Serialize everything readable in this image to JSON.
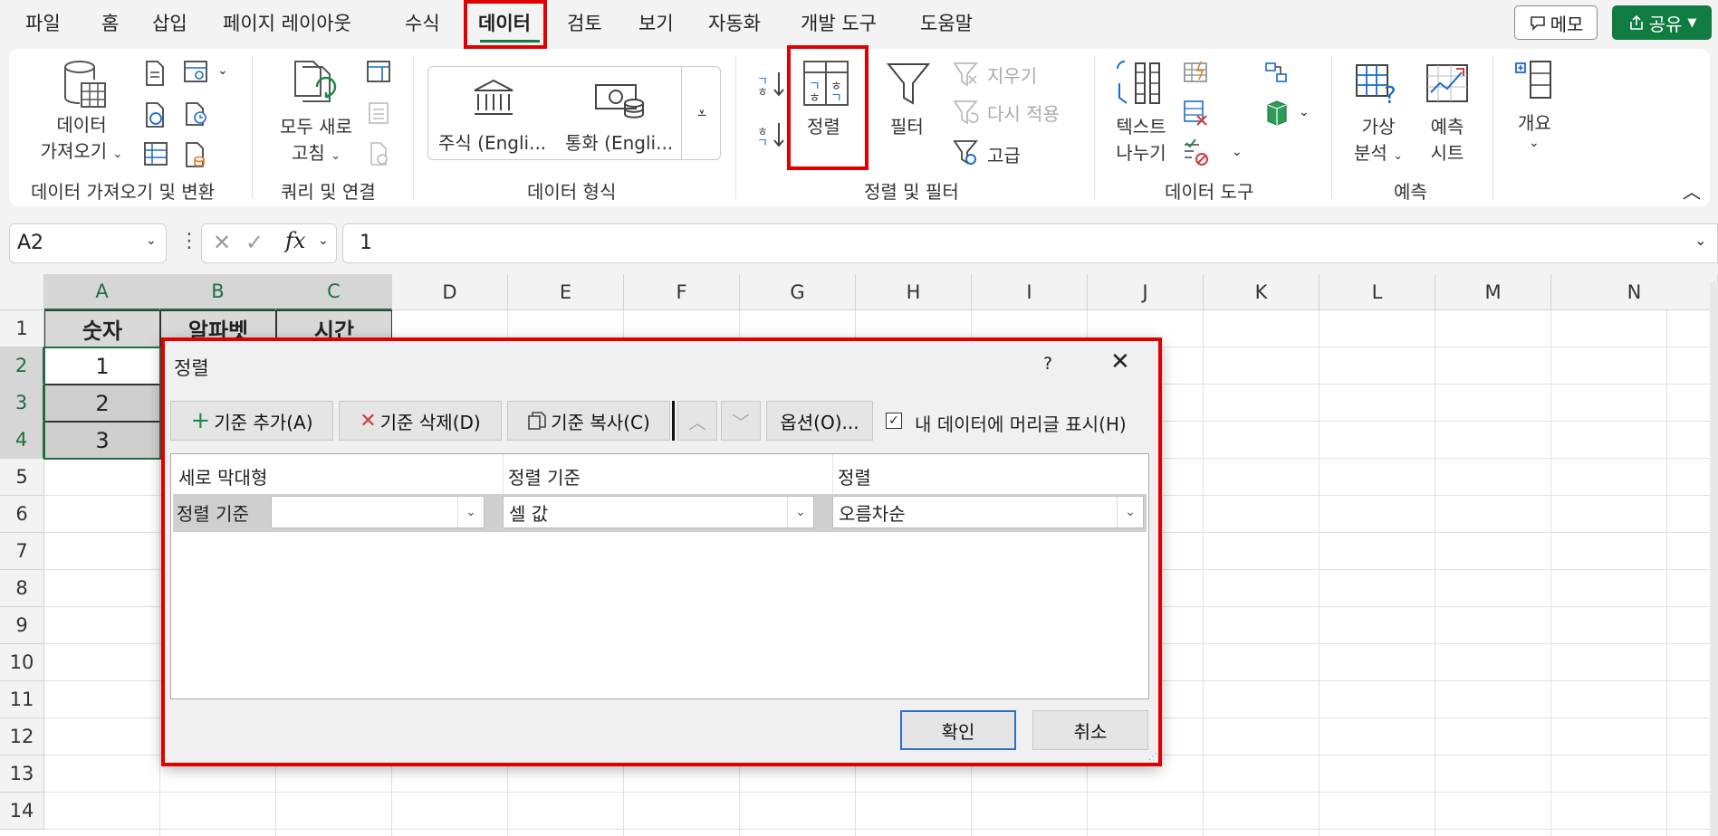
{
  "menu": {
    "items": [
      "파일",
      "홈",
      "삽입",
      "페이지 레이아웃",
      "수식",
      "데이터",
      "검토",
      "보기",
      "자동화",
      "개발 도구",
      "도움말"
    ],
    "active_index": 5,
    "comment_button": "메모",
    "share_button": "공유"
  },
  "ribbon": {
    "get_data": {
      "line1": "데이터",
      "line2": "가져오기"
    },
    "refresh_all": {
      "line1": "모두 새로",
      "line2": "고침"
    },
    "stocks": "주식 (Engli...",
    "currencies": "통화 (Engli...",
    "sort": "정렬",
    "filter": "필터",
    "clear": "지우기",
    "reapply": "다시 적용",
    "advanced": "고급",
    "text_to_columns": {
      "line1": "텍스트",
      "line2": "나누기"
    },
    "what_if": {
      "line1": "가상",
      "line2": "분석"
    },
    "forecast": {
      "line1": "예측",
      "line2": "시트"
    },
    "outline": "개요",
    "groups": {
      "get_transform": "데이터 가져오기 및 변환",
      "queries": "쿼리 및 연결",
      "data_types": "데이터 형식",
      "sort_filter": "정렬 및 필터",
      "data_tools": "데이터 도구",
      "forecast": "예측"
    }
  },
  "formula_bar": {
    "name_box": "A2",
    "formula": "1"
  },
  "sheet": {
    "columns": [
      "A",
      "B",
      "C",
      "D",
      "E",
      "F",
      "G",
      "H",
      "I",
      "J",
      "K",
      "L",
      "M",
      "N"
    ],
    "rows": [
      "1",
      "2",
      "3",
      "4",
      "5",
      "6",
      "7",
      "8",
      "9",
      "10",
      "11",
      "12",
      "13",
      "14"
    ],
    "headers": {
      "A1": "숫자",
      "B1": "알파벳",
      "C1": "시간"
    },
    "values": {
      "A2": "1",
      "A3": "2",
      "A4": "3"
    }
  },
  "dialog": {
    "title": "정렬",
    "help": "?",
    "add_level": "기준 추가(A)",
    "delete_level": "기준 삭제(D)",
    "copy_level": "기준 복사(C)",
    "options": "옵션(O)...",
    "has_headers_label": "내 데이터에 머리글 표시(H)",
    "has_headers_checked": true,
    "col_header_column": "세로 막대형",
    "col_header_sort_on": "정렬 기준",
    "col_header_order": "정렬",
    "row_label": "정렬 기준",
    "column_value": "",
    "sort_on_value": "셀 값",
    "order_value": "오름차순",
    "ok": "확인",
    "cancel": "취소"
  }
}
